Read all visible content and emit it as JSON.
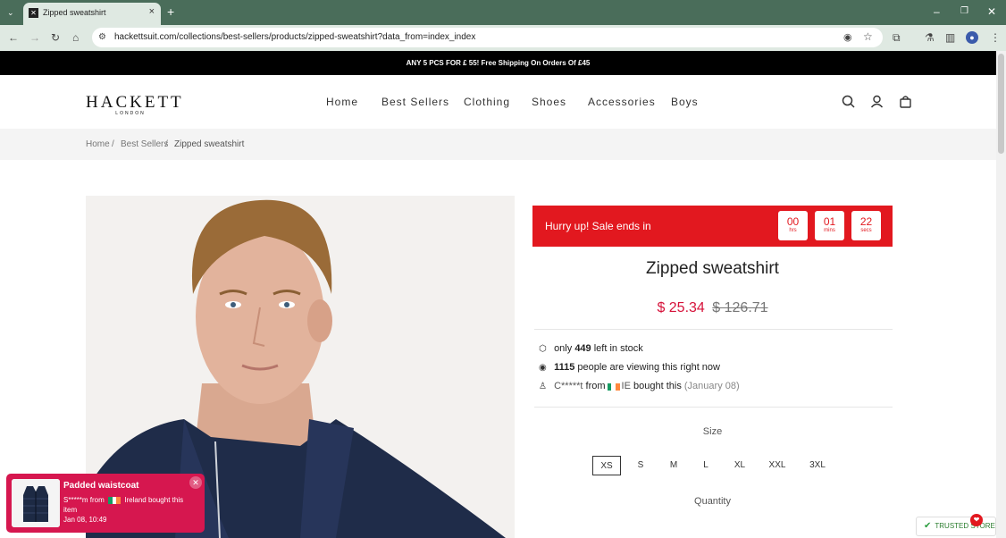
{
  "browser": {
    "tab_title": "Zipped sweatshirt",
    "url": "hackettsuit.com/collections/best-sellers/products/zipped-sweatshirt?data_from=index_index"
  },
  "announcement": "ANY 5 PCS FOR £ 55! Free Shipping On Orders Of £45",
  "header": {
    "logo_main": "HACKETT",
    "logo_sub": "LONDON",
    "nav": [
      "Home",
      "Best Sellers",
      "Clothing",
      "Shoes",
      "Accessories",
      "Boys"
    ]
  },
  "breadcrumb": [
    "Home",
    "/",
    "Best Sellers",
    "/",
    "Zipped sweatshirt"
  ],
  "sale": {
    "label": "Hurry up!  Sale ends in",
    "countdown": [
      {
        "value": "00",
        "unit": "hrs"
      },
      {
        "value": "01",
        "unit": "mins"
      },
      {
        "value": "22",
        "unit": "secs"
      }
    ]
  },
  "product": {
    "title": "Zipped sweatshirt",
    "price_now": "$ 25.34",
    "price_was": "$ 126.71",
    "stock_pre": "only",
    "stock_count": "449",
    "stock_post": "left in stock",
    "viewers_count": "1115",
    "viewers_post": "people are viewing this right now",
    "buyer_name": "C*****t",
    "buyer_from": "from",
    "buyer_country": "IE",
    "buyer_action": "bought this",
    "buyer_date": "(January 08)",
    "size_label": "Size",
    "sizes": [
      "XS",
      "S",
      "M",
      "L",
      "XL",
      "XXL",
      "3XL"
    ],
    "selected_size": "XS",
    "quantity_label": "Quantity"
  },
  "popup": {
    "title": "Padded waistcoat",
    "buyer": "S*****m from",
    "country": "Ireland bought this",
    "suffix": "item",
    "time": "Jan 08, 10:49"
  },
  "trusted": "TRUSTED STORE",
  "colors": {
    "sale_red": "#e2181f",
    "price_pink": "#d6123a",
    "popup_pink": "#d6174f",
    "chrome_green": "#4a6d5a"
  }
}
